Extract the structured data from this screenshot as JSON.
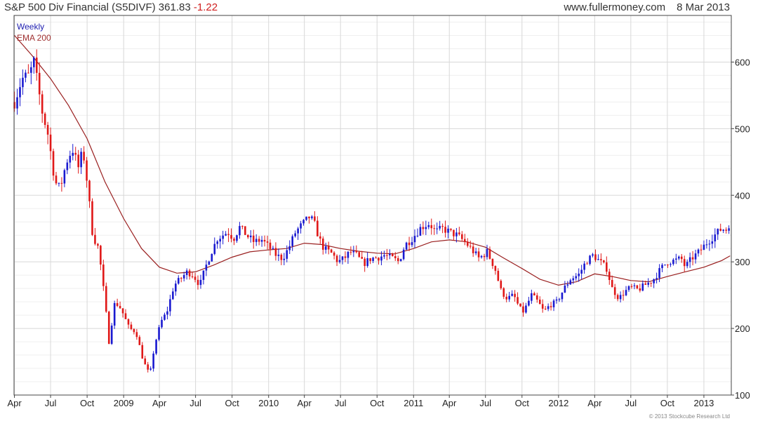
{
  "header": {
    "title": "S&P 500 Div Financial (S5DIVF) 361.83",
    "change": "-1.22",
    "site": "www.fullermoney.com",
    "date": "8 Mar 2013"
  },
  "footer": {
    "copyright": "© 2013 Stockcube Research Ltd"
  },
  "colors": {
    "up": "#1a1ad0",
    "down": "#e01818",
    "ema": "#9a2020",
    "grid": "#d8d8d8",
    "axis": "#444444"
  },
  "chart_data": {
    "type": "candlestick",
    "frequency": "weekly",
    "legend": [
      "Weekly",
      "EMA 200"
    ],
    "legend_position": "top-left",
    "grid": true,
    "ylim": [
      100,
      670
    ],
    "y_ticks": [
      100,
      200,
      300,
      400,
      500,
      600
    ],
    "y_axis_position": "right",
    "x_range": [
      "2008-03-31",
      "2013-03-11"
    ],
    "x_ticks": [
      {
        "label": "Apr",
        "date": "2008-04-01"
      },
      {
        "label": "Jul",
        "date": "2008-07-01"
      },
      {
        "label": "Oct",
        "date": "2008-10-01"
      },
      {
        "label": "2009",
        "date": "2009-01-01"
      },
      {
        "label": "Apr",
        "date": "2009-04-01"
      },
      {
        "label": "Jul",
        "date": "2009-07-01"
      },
      {
        "label": "Oct",
        "date": "2009-10-01"
      },
      {
        "label": "2010",
        "date": "2010-01-01"
      },
      {
        "label": "Apr",
        "date": "2010-04-01"
      },
      {
        "label": "Jul",
        "date": "2010-07-01"
      },
      {
        "label": "Oct",
        "date": "2010-10-01"
      },
      {
        "label": "2011",
        "date": "2011-01-01"
      },
      {
        "label": "Apr",
        "date": "2011-04-01"
      },
      {
        "label": "Jul",
        "date": "2011-07-01"
      },
      {
        "label": "Oct",
        "date": "2011-10-01"
      },
      {
        "label": "2012",
        "date": "2012-01-01"
      },
      {
        "label": "Apr",
        "date": "2012-04-01"
      },
      {
        "label": "Jul",
        "date": "2012-07-01"
      },
      {
        "label": "Oct",
        "date": "2012-10-01"
      },
      {
        "label": "2013",
        "date": "2013-01-01"
      }
    ],
    "price_path": [
      [
        "2008-04-01",
        540
      ],
      [
        "2008-04-20",
        575
      ],
      [
        "2008-05-08",
        580
      ],
      [
        "2008-05-20",
        600
      ],
      [
        "2008-06-10",
        525
      ],
      [
        "2008-06-25",
        490
      ],
      [
        "2008-07-12",
        420
      ],
      [
        "2008-07-25",
        410
      ],
      [
        "2008-08-10",
        450
      ],
      [
        "2008-08-25",
        470
      ],
      [
        "2008-09-10",
        440
      ],
      [
        "2008-09-20",
        470
      ],
      [
        "2008-10-01",
        420
      ],
      [
        "2008-10-15",
        340
      ],
      [
        "2008-10-30",
        320
      ],
      [
        "2008-11-15",
        240
      ],
      [
        "2008-11-25",
        180
      ],
      [
        "2008-12-10",
        240
      ],
      [
        "2008-12-25",
        230
      ],
      [
        "2009-01-15",
        200
      ],
      [
        "2009-02-01",
        195
      ],
      [
        "2009-02-20",
        150
      ],
      [
        "2009-03-08",
        130
      ],
      [
        "2009-03-20",
        175
      ],
      [
        "2009-04-05",
        210
      ],
      [
        "2009-04-20",
        225
      ],
      [
        "2009-05-08",
        265
      ],
      [
        "2009-05-25",
        275
      ],
      [
        "2009-06-10",
        285
      ],
      [
        "2009-06-25",
        280
      ],
      [
        "2009-07-12",
        265
      ],
      [
        "2009-07-25",
        290
      ],
      [
        "2009-08-10",
        315
      ],
      [
        "2009-08-25",
        335
      ],
      [
        "2009-09-20",
        345
      ],
      [
        "2009-10-05",
        335
      ],
      [
        "2009-10-20",
        352
      ],
      [
        "2009-11-10",
        338
      ],
      [
        "2009-11-25",
        330
      ],
      [
        "2009-12-15",
        333
      ],
      [
        "2010-01-05",
        320
      ],
      [
        "2010-01-20",
        310
      ],
      [
        "2010-02-05",
        305
      ],
      [
        "2010-02-20",
        320
      ],
      [
        "2010-03-10",
        345
      ],
      [
        "2010-03-25",
        355
      ],
      [
        "2010-04-15",
        368
      ],
      [
        "2010-04-28",
        355
      ],
      [
        "2010-05-08",
        335
      ],
      [
        "2010-05-20",
        320
      ],
      [
        "2010-06-10",
        312
      ],
      [
        "2010-06-25",
        300
      ],
      [
        "2010-07-10",
        305
      ],
      [
        "2010-07-25",
        315
      ],
      [
        "2010-08-10",
        310
      ],
      [
        "2010-08-28",
        297
      ],
      [
        "2010-09-15",
        305
      ],
      [
        "2010-10-05",
        307
      ],
      [
        "2010-10-20",
        310
      ],
      [
        "2010-11-10",
        305
      ],
      [
        "2010-11-25",
        300
      ],
      [
        "2010-12-10",
        325
      ],
      [
        "2010-12-28",
        335
      ],
      [
        "2011-01-20",
        352
      ],
      [
        "2011-02-10",
        358
      ],
      [
        "2011-02-25",
        345
      ],
      [
        "2011-03-15",
        350
      ],
      [
        "2011-04-01",
        345
      ],
      [
        "2011-04-20",
        340
      ],
      [
        "2011-05-10",
        330
      ],
      [
        "2011-05-25",
        320
      ],
      [
        "2011-06-15",
        305
      ],
      [
        "2011-07-05",
        315
      ],
      [
        "2011-07-25",
        290
      ],
      [
        "2011-08-10",
        255
      ],
      [
        "2011-08-25",
        245
      ],
      [
        "2011-09-10",
        250
      ],
      [
        "2011-09-25",
        230
      ],
      [
        "2011-10-05",
        225
      ],
      [
        "2011-10-25",
        250
      ],
      [
        "2011-11-10",
        240
      ],
      [
        "2011-11-25",
        225
      ],
      [
        "2011-12-10",
        235
      ],
      [
        "2011-12-28",
        240
      ],
      [
        "2012-01-15",
        260
      ],
      [
        "2012-02-01",
        275
      ],
      [
        "2012-02-20",
        280
      ],
      [
        "2012-03-10",
        300
      ],
      [
        "2012-03-28",
        310
      ],
      [
        "2012-04-15",
        300
      ],
      [
        "2012-05-01",
        290
      ],
      [
        "2012-05-15",
        260
      ],
      [
        "2012-06-01",
        245
      ],
      [
        "2012-06-15",
        255
      ],
      [
        "2012-07-01",
        262
      ],
      [
        "2012-07-20",
        258
      ],
      [
        "2012-08-05",
        265
      ],
      [
        "2012-08-25",
        272
      ],
      [
        "2012-09-15",
        290
      ],
      [
        "2012-10-01",
        300
      ],
      [
        "2012-10-20",
        302
      ],
      [
        "2012-11-05",
        305
      ],
      [
        "2012-11-15",
        292
      ],
      [
        "2012-12-01",
        305
      ],
      [
        "2012-12-20",
        315
      ],
      [
        "2013-01-10",
        330
      ],
      [
        "2013-01-28",
        340
      ],
      [
        "2013-02-15",
        350
      ],
      [
        "2013-02-28",
        348
      ],
      [
        "2013-03-08",
        361.83
      ]
    ],
    "ema_200": [
      [
        "2008-04-01",
        640
      ],
      [
        "2008-05-15",
        610
      ],
      [
        "2008-07-01",
        575
      ],
      [
        "2008-08-15",
        535
      ],
      [
        "2008-10-01",
        485
      ],
      [
        "2008-11-15",
        420
      ],
      [
        "2009-01-01",
        365
      ],
      [
        "2009-02-15",
        320
      ],
      [
        "2009-04-01",
        292
      ],
      [
        "2009-05-15",
        283
      ],
      [
        "2009-07-01",
        285
      ],
      [
        "2009-08-15",
        295
      ],
      [
        "2009-10-01",
        307
      ],
      [
        "2009-11-15",
        315
      ],
      [
        "2010-01-01",
        318
      ],
      [
        "2010-02-15",
        320
      ],
      [
        "2010-04-01",
        328
      ],
      [
        "2010-05-15",
        326
      ],
      [
        "2010-07-01",
        320
      ],
      [
        "2010-08-15",
        316
      ],
      [
        "2010-10-01",
        313
      ],
      [
        "2010-11-15",
        312
      ],
      [
        "2011-01-01",
        320
      ],
      [
        "2011-02-15",
        330
      ],
      [
        "2011-04-01",
        333
      ],
      [
        "2011-05-15",
        330
      ],
      [
        "2011-07-01",
        322
      ],
      [
        "2011-08-15",
        306
      ],
      [
        "2011-10-01",
        290
      ],
      [
        "2011-11-15",
        274
      ],
      [
        "2012-01-01",
        265
      ],
      [
        "2012-02-15",
        270
      ],
      [
        "2012-04-01",
        282
      ],
      [
        "2012-05-15",
        278
      ],
      [
        "2012-07-01",
        272
      ],
      [
        "2012-08-15",
        270
      ],
      [
        "2012-10-01",
        278
      ],
      [
        "2012-11-15",
        285
      ],
      [
        "2013-01-01",
        292
      ],
      [
        "2013-02-15",
        302
      ],
      [
        "2013-03-08",
        309
      ]
    ]
  }
}
